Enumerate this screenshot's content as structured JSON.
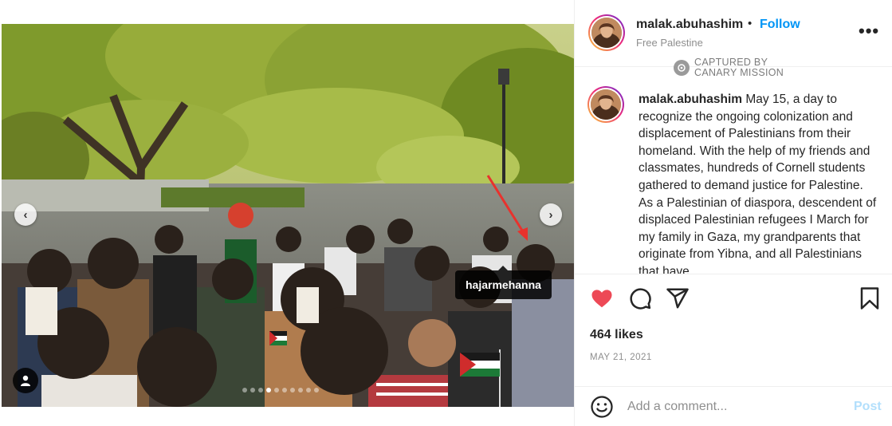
{
  "post": {
    "tagged_user_label": "hajarmehanna",
    "carousel_dot_count": 10,
    "carousel_active_index": 3
  },
  "header": {
    "username": "malak.abuhashim",
    "separator": "•",
    "follow_label": "Follow",
    "location": "Free Palestine",
    "more_icon": "more-horizontal-icon"
  },
  "watermark": {
    "line1": "CAPTURED BY",
    "line2": "CANARY MISSION"
  },
  "caption": {
    "username": "malak.abuhashim",
    "text": " May 15, a day to recognize the ongoing colonization and displacement of Palestinians from their homeland. With the help of my friends and classmates, hundreds of Cornell students gathered to demand justice for Palestine. As a Palestinian of diaspora, descendent of displaced Palestinian refugees I March for my family in Gaza, my grandparents that originate from Yibna, and all Palestinians that have"
  },
  "actions": {
    "like_icon": "heart-icon",
    "comment_icon": "comment-icon",
    "share_icon": "share-icon",
    "save_icon": "bookmark-icon",
    "liked_color": "#ed4956"
  },
  "stats": {
    "likes": "464 likes",
    "date": "MAY 21, 2021"
  },
  "comment": {
    "placeholder": "Add a comment...",
    "post_label": "Post"
  },
  "colors": {
    "accent": "#0095f6",
    "post_disabled": "#b2dffc",
    "muted": "#8e8e8e"
  }
}
